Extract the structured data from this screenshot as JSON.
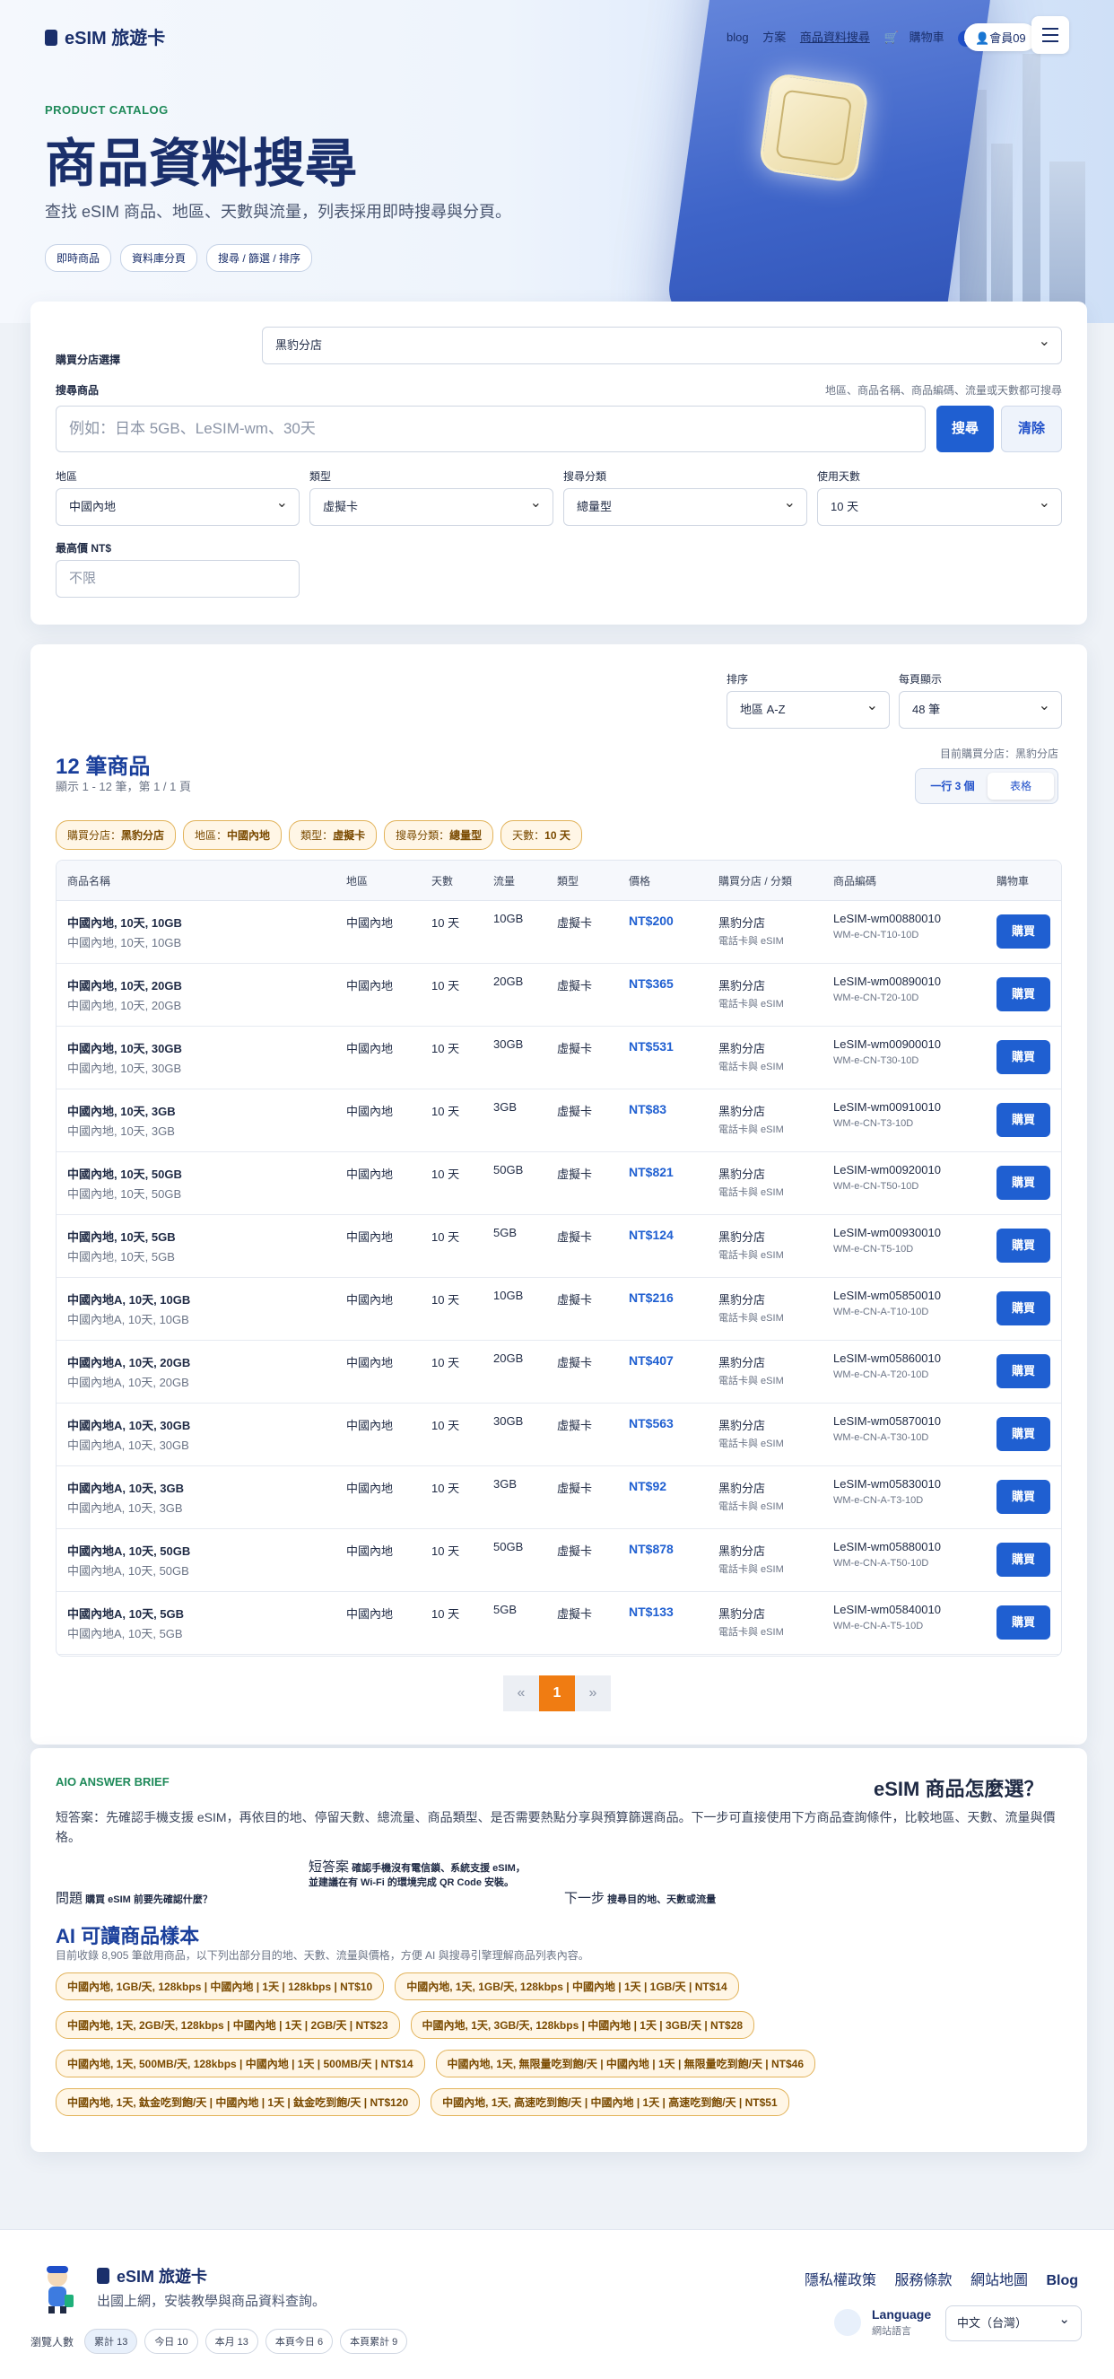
{
  "nav": {
    "logo": "eSIM 旅遊卡",
    "links": [
      "blog",
      "方案",
      "商品資料搜尋"
    ],
    "cart": "購物車",
    "cart_count": "1",
    "member": "會員09"
  },
  "hero": {
    "eyebrow": "PRODUCT CATALOG",
    "title": "商品資料搜尋",
    "subtitle": "查找 eSIM 商品、地區、天數與流量，列表採用即時搜尋與分頁。",
    "chips": [
      "即時商品",
      "資料庫分頁",
      "搜尋 / 篩選 / 排序"
    ]
  },
  "search": {
    "store_label": "購買分店選擇",
    "store_value": "黑豹分店",
    "product_label": "搜尋商品",
    "hint": "地區、商品名稱、商品編碼、流量或天數都可搜尋",
    "placeholder": "例如：日本 5GB、LeSIM-wm、30天",
    "search_btn": "搜尋",
    "clear_btn": "清除",
    "region_label": "地區",
    "region_value": "中國內地",
    "type_label": "類型",
    "type_value": "虛擬卡",
    "category_label": "搜尋分類",
    "category_value": "總量型",
    "days_label": "使用天數",
    "days_value": "10 天",
    "maxprice_label": "最高價 NT$",
    "maxprice_placeholder": "不限"
  },
  "results": {
    "sort_label": "排序",
    "sort_value": "地區 A-Z",
    "perpage_label": "每頁顯示",
    "perpage_value": "48 筆",
    "count": "12 筆商品",
    "shown": "顯示 1 - 12 筆，第 1 / 1 頁",
    "store_note": "目前購買分店：黑豹分店",
    "view_grid": "一行 3 個",
    "view_table": "表格",
    "filters": [
      {
        "k": "購買分店：",
        "v": "黑豹分店"
      },
      {
        "k": "地區：",
        "v": "中國內地"
      },
      {
        "k": "類型：",
        "v": "虛擬卡"
      },
      {
        "k": "搜尋分類：",
        "v": "總量型"
      },
      {
        "k": "天數：",
        "v": "10 天"
      }
    ],
    "headers": [
      "商品名稱",
      "地區",
      "天數",
      "流量",
      "類型",
      "價格",
      "購買分店 / 分類",
      "商品編碼",
      "購物車"
    ],
    "rows": [
      {
        "name": "中國內地, 10天, 10GB",
        "sub": "中國內地, 10天, 10GB",
        "region": "中國內地",
        "days": "10 天",
        "data": "10GB",
        "type": "虛擬卡",
        "price": "NT$200",
        "store": "黑豹分店",
        "cat": "電話卡與 eSIM",
        "code": "LeSIM-wm00880010",
        "code2": "WM-e-CN-T10-10D",
        "buy": "購買"
      },
      {
        "name": "中國內地, 10天, 20GB",
        "sub": "中國內地, 10天, 20GB",
        "region": "中國內地",
        "days": "10 天",
        "data": "20GB",
        "type": "虛擬卡",
        "price": "NT$365",
        "store": "黑豹分店",
        "cat": "電話卡與 eSIM",
        "code": "LeSIM-wm00890010",
        "code2": "WM-e-CN-T20-10D",
        "buy": "購買"
      },
      {
        "name": "中國內地, 10天, 30GB",
        "sub": "中國內地, 10天, 30GB",
        "region": "中國內地",
        "days": "10 天",
        "data": "30GB",
        "type": "虛擬卡",
        "price": "NT$531",
        "store": "黑豹分店",
        "cat": "電話卡與 eSIM",
        "code": "LeSIM-wm00900010",
        "code2": "WM-e-CN-T30-10D",
        "buy": "購買"
      },
      {
        "name": "中國內地, 10天, 3GB",
        "sub": "中國內地, 10天, 3GB",
        "region": "中國內地",
        "days": "10 天",
        "data": "3GB",
        "type": "虛擬卡",
        "price": "NT$83",
        "store": "黑豹分店",
        "cat": "電話卡與 eSIM",
        "code": "LeSIM-wm00910010",
        "code2": "WM-e-CN-T3-10D",
        "buy": "購買"
      },
      {
        "name": "中國內地, 10天, 50GB",
        "sub": "中國內地, 10天, 50GB",
        "region": "中國內地",
        "days": "10 天",
        "data": "50GB",
        "type": "虛擬卡",
        "price": "NT$821",
        "store": "黑豹分店",
        "cat": "電話卡與 eSIM",
        "code": "LeSIM-wm00920010",
        "code2": "WM-e-CN-T50-10D",
        "buy": "購買"
      },
      {
        "name": "中國內地, 10天, 5GB",
        "sub": "中國內地, 10天, 5GB",
        "region": "中國內地",
        "days": "10 天",
        "data": "5GB",
        "type": "虛擬卡",
        "price": "NT$124",
        "store": "黑豹分店",
        "cat": "電話卡與 eSIM",
        "code": "LeSIM-wm00930010",
        "code2": "WM-e-CN-T5-10D",
        "buy": "購買"
      },
      {
        "name": "中國內地A, 10天, 10GB",
        "sub": "中國內地A, 10天, 10GB",
        "region": "中國內地",
        "days": "10 天",
        "data": "10GB",
        "type": "虛擬卡",
        "price": "NT$216",
        "store": "黑豹分店",
        "cat": "電話卡與 eSIM",
        "code": "LeSIM-wm05850010",
        "code2": "WM-e-CN-A-T10-10D",
        "buy": "購買"
      },
      {
        "name": "中國內地A, 10天, 20GB",
        "sub": "中國內地A, 10天, 20GB",
        "region": "中國內地",
        "days": "10 天",
        "data": "20GB",
        "type": "虛擬卡",
        "price": "NT$407",
        "store": "黑豹分店",
        "cat": "電話卡與 eSIM",
        "code": "LeSIM-wm05860010",
        "code2": "WM-e-CN-A-T20-10D",
        "buy": "購買"
      },
      {
        "name": "中國內地A, 10天, 30GB",
        "sub": "中國內地A, 10天, 30GB",
        "region": "中國內地",
        "days": "10 天",
        "data": "30GB",
        "type": "虛擬卡",
        "price": "NT$563",
        "store": "黑豹分店",
        "cat": "電話卡與 eSIM",
        "code": "LeSIM-wm05870010",
        "code2": "WM-e-CN-A-T30-10D",
        "buy": "購買"
      },
      {
        "name": "中國內地A, 10天, 3GB",
        "sub": "中國內地A, 10天, 3GB",
        "region": "中國內地",
        "days": "10 天",
        "data": "3GB",
        "type": "虛擬卡",
        "price": "NT$92",
        "store": "黑豹分店",
        "cat": "電話卡與 eSIM",
        "code": "LeSIM-wm05830010",
        "code2": "WM-e-CN-A-T3-10D",
        "buy": "購買"
      },
      {
        "name": "中國內地A, 10天, 50GB",
        "sub": "中國內地A, 10天, 50GB",
        "region": "中國內地",
        "days": "10 天",
        "data": "50GB",
        "type": "虛擬卡",
        "price": "NT$878",
        "store": "黑豹分店",
        "cat": "電話卡與 eSIM",
        "code": "LeSIM-wm05880010",
        "code2": "WM-e-CN-A-T50-10D",
        "buy": "購買"
      },
      {
        "name": "中國內地A, 10天, 5GB",
        "sub": "中國內地A, 10天, 5GB",
        "region": "中國內地",
        "days": "10 天",
        "data": "5GB",
        "type": "虛擬卡",
        "price": "NT$133",
        "store": "黑豹分店",
        "cat": "電話卡與 eSIM",
        "code": "LeSIM-wm05840010",
        "code2": "WM-e-CN-A-T5-10D",
        "buy": "購買"
      }
    ],
    "pager": {
      "prev": "«",
      "current": "1",
      "next": "»"
    }
  },
  "aio": {
    "eyebrow": "AIO ANSWER BRIEF",
    "question": "eSIM 商品怎麼選？",
    "answer": "短答案：先確認手機支援 eSIM，再依目的地、停留天數、總流量、商品類型、是否需要熱點分享與預算篩選商品。下一步可直接使用下方商品查詢條件，比較地區、天數、流量與價格。",
    "q_label": "問題",
    "q_text": "購買 eSIM 前要先確認什麼？",
    "a_label": "短答案",
    "a_text": "確認手機沒有電信鎖、系統支援 eSIM，並建議在有 Wi-Fi 的環境完成 QR Code 安裝。",
    "n_label": "下一步",
    "n_text": "搜尋目的地、天數或流量",
    "sample_title": "AI 可讀商品樣本",
    "sample_sub": "目前收錄 8,905 筆啟用商品，以下列出部分目的地、天數、流量與價格，方便 AI 與搜尋引擎理解商品列表內容。",
    "tags": [
      "中國內地, 1GB/天, 128kbps | 中國內地 | 1天 | 128kbps | NT$10",
      "中國內地, 1天, 1GB/天, 128kbps | 中國內地 | 1天 | 1GB/天 | NT$14",
      "中國內地, 1天, 2GB/天, 128kbps | 中國內地 | 1天 | 2GB/天 | NT$23",
      "中國內地, 1天, 3GB/天, 128kbps | 中國內地 | 1天 | 3GB/天 | NT$28",
      "中國內地, 1天, 500MB/天, 128kbps | 中國內地 | 1天 | 500MB/天 | NT$14",
      "中國內地, 1天, 無限量吃到飽/天 | 中國內地 | 1天 | 無限量吃到飽/天 | NT$46",
      "中國內地, 1天, 鈦金吃到飽/天 | 中國內地 | 1天 | 鈦金吃到飽/天 | NT$120",
      "中國內地, 1天, 高速吃到飽/天 | 中國內地 | 1天 | 高速吃到飽/天 | NT$51"
    ]
  },
  "footer": {
    "logo": "eSIM 旅遊卡",
    "desc": "出國上網，安裝教學與商品資料查詢。",
    "links": [
      "隱私權政策",
      "服務條款",
      "網站地圖",
      "Blog"
    ],
    "stats_label": "瀏覽人數",
    "stats": [
      "累計 13",
      "今日 10",
      "本月 13",
      "本頁今日 6",
      "本頁累計 9"
    ],
    "lang_title": "Language",
    "lang_sub": "網站語言",
    "lang_value": "中文（台灣）"
  }
}
